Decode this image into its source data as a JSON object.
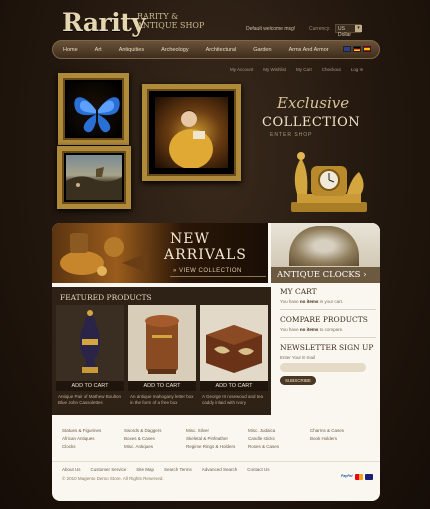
{
  "header": {
    "logo": "Rarity",
    "tagline_line1": "RARITY &",
    "tagline_line2": "ANTIQUE SHOP",
    "welcome": "Default welcome msg!",
    "currency_label": "Currency:",
    "currency_value": "US Dollar"
  },
  "nav": {
    "items": [
      "Home",
      "Art",
      "Antiquities",
      "Archeology",
      "Architectural",
      "Garden",
      "Arms And Armor"
    ]
  },
  "account_links": [
    "My Account",
    "My Wishlist",
    "My Cart",
    "Checkout",
    "Log In"
  ],
  "hero": {
    "exclusive": "Exclusive",
    "collection": "COLLECTION",
    "enter": "ENTER SHOP"
  },
  "banners": {
    "new_line1": "NEW",
    "new_line2": "ARRIVALS",
    "view": "» VIEW COLLECTION",
    "antique_clocks": "ANTIQUE CLOCKS ›"
  },
  "featured": {
    "title": "FEATURED PRODUCTS",
    "products": [
      {
        "button": "ADD TO CART",
        "desc": "Antique Pair of Mathew Boulton Blue John Cassolettes"
      },
      {
        "button": "ADD TO CART",
        "desc": "An antique mahogany letter box in the form of a free box"
      },
      {
        "button": "ADD TO CART",
        "desc": "A George III rosewood and tea caddy inlaid with Ivory"
      }
    ]
  },
  "sidebar": {
    "cart_title": "MY CART",
    "cart_text_1": "You have",
    "cart_text_bold": "no items",
    "cart_text_2": "in your cart.",
    "compare_title": "COMPARE PRODUCTS",
    "compare_text_1": "You have",
    "compare_text_bold": "no items",
    "compare_text_2": "to compare.",
    "newsletter_title": "NEWSLETTER SIGN UP",
    "newsletter_label": "Enter Your E-mail",
    "subscribe": "SUBSCRIBE"
  },
  "footer": {
    "columns": [
      [
        "Statues & Figurines",
        "African Antiques",
        "Clocks"
      ],
      [
        "Swords & Daggers",
        "Boxes & Cases",
        "Misc. Antiques"
      ],
      [
        "Misc. Silver",
        "Skeletal & Pinfeather",
        "Regime Rings & Holders"
      ],
      [
        "Misc. Judaica",
        "Candle sticks",
        "Roses & Cases"
      ],
      [
        "Charms & Cases",
        "Book Holders"
      ]
    ],
    "links": [
      "About Us",
      "Customer Service",
      "Site Map",
      "Search Terms",
      "Advanced Search",
      "Contact Us"
    ],
    "copyright": "© 2010 Magento Demo Store. All Rights Reserved.",
    "paypal": "PayPal"
  }
}
